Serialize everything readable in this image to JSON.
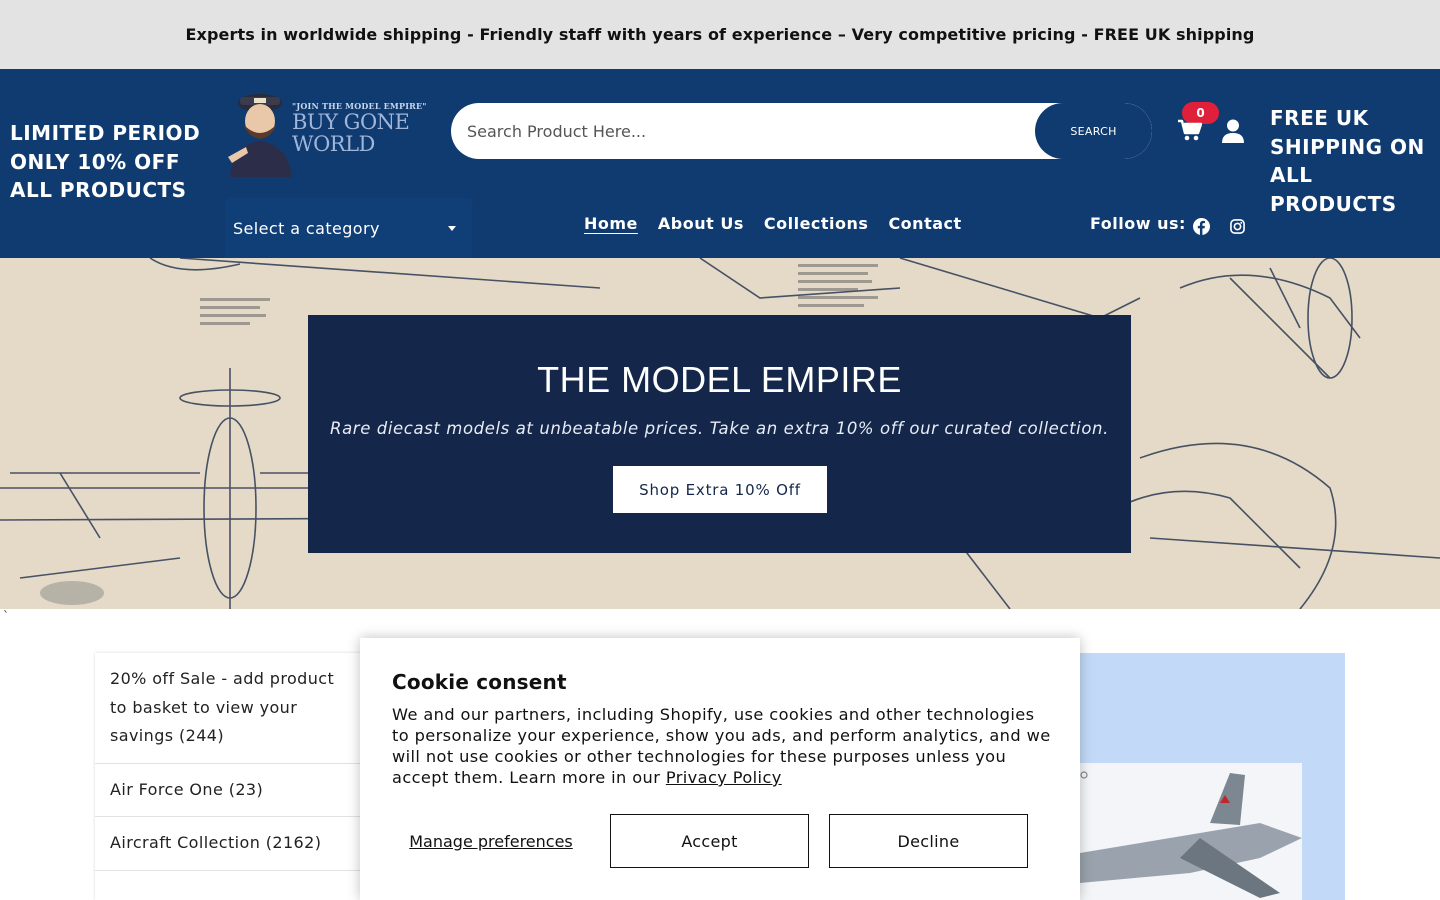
{
  "announcement": "Experts in worldwide shipping - Friendly staff with years of experience – Very competitive pricing - FREE UK shipping",
  "header": {
    "promo_left": "LIMITED PERIOD ONLY 10% OFF ALL PRODUCTS",
    "promo_right": "FREE UK SHIPPING ON ALL PRODUCTS",
    "logo": {
      "tagline": "\"JOIN THE MODEL EMPIRE\"",
      "line1": "BUY GONE",
      "line2": "WORLD"
    },
    "search": {
      "placeholder": "Search Product Here...",
      "button_label": "SEARCH"
    },
    "cart_count": "0",
    "category_select": "Select a category",
    "nav": [
      "Home",
      "About Us",
      "Collections",
      "Contact"
    ],
    "follow_label": "Follow us:",
    "icons": [
      "cart-icon",
      "user-icon",
      "facebook-icon",
      "instagram-icon",
      "chevron-down-icon"
    ]
  },
  "hero": {
    "title": "THE MODEL EMPIRE",
    "subtitle": "Rare diecast models at unbeatable prices. Take an extra 10% off our curated collection.",
    "button_label": "Shop Extra 10% Off"
  },
  "stray_mark": "`",
  "sidebar": {
    "items": [
      "20% off Sale - add product to basket to view your savings (244)",
      "Air Force One (23)",
      "Aircraft Collection (2162)"
    ]
  },
  "cookie": {
    "title": "Cookie consent",
    "body": "We and our partners, including Shopify, use cookies and other technologies to personalize your experience, show you ads, and perform analytics, and we will not use cookies or other technologies for these purposes unless you accept them. Learn more in our ",
    "policy_link": "Privacy Policy",
    "manage_label": "Manage preferences",
    "accept_label": "Accept",
    "decline_label": "Decline"
  },
  "colors": {
    "header_bg": "#0f3b70",
    "hero_box": "#14274a",
    "badge": "#e0203a",
    "promo_panel": "#c2daf8"
  }
}
